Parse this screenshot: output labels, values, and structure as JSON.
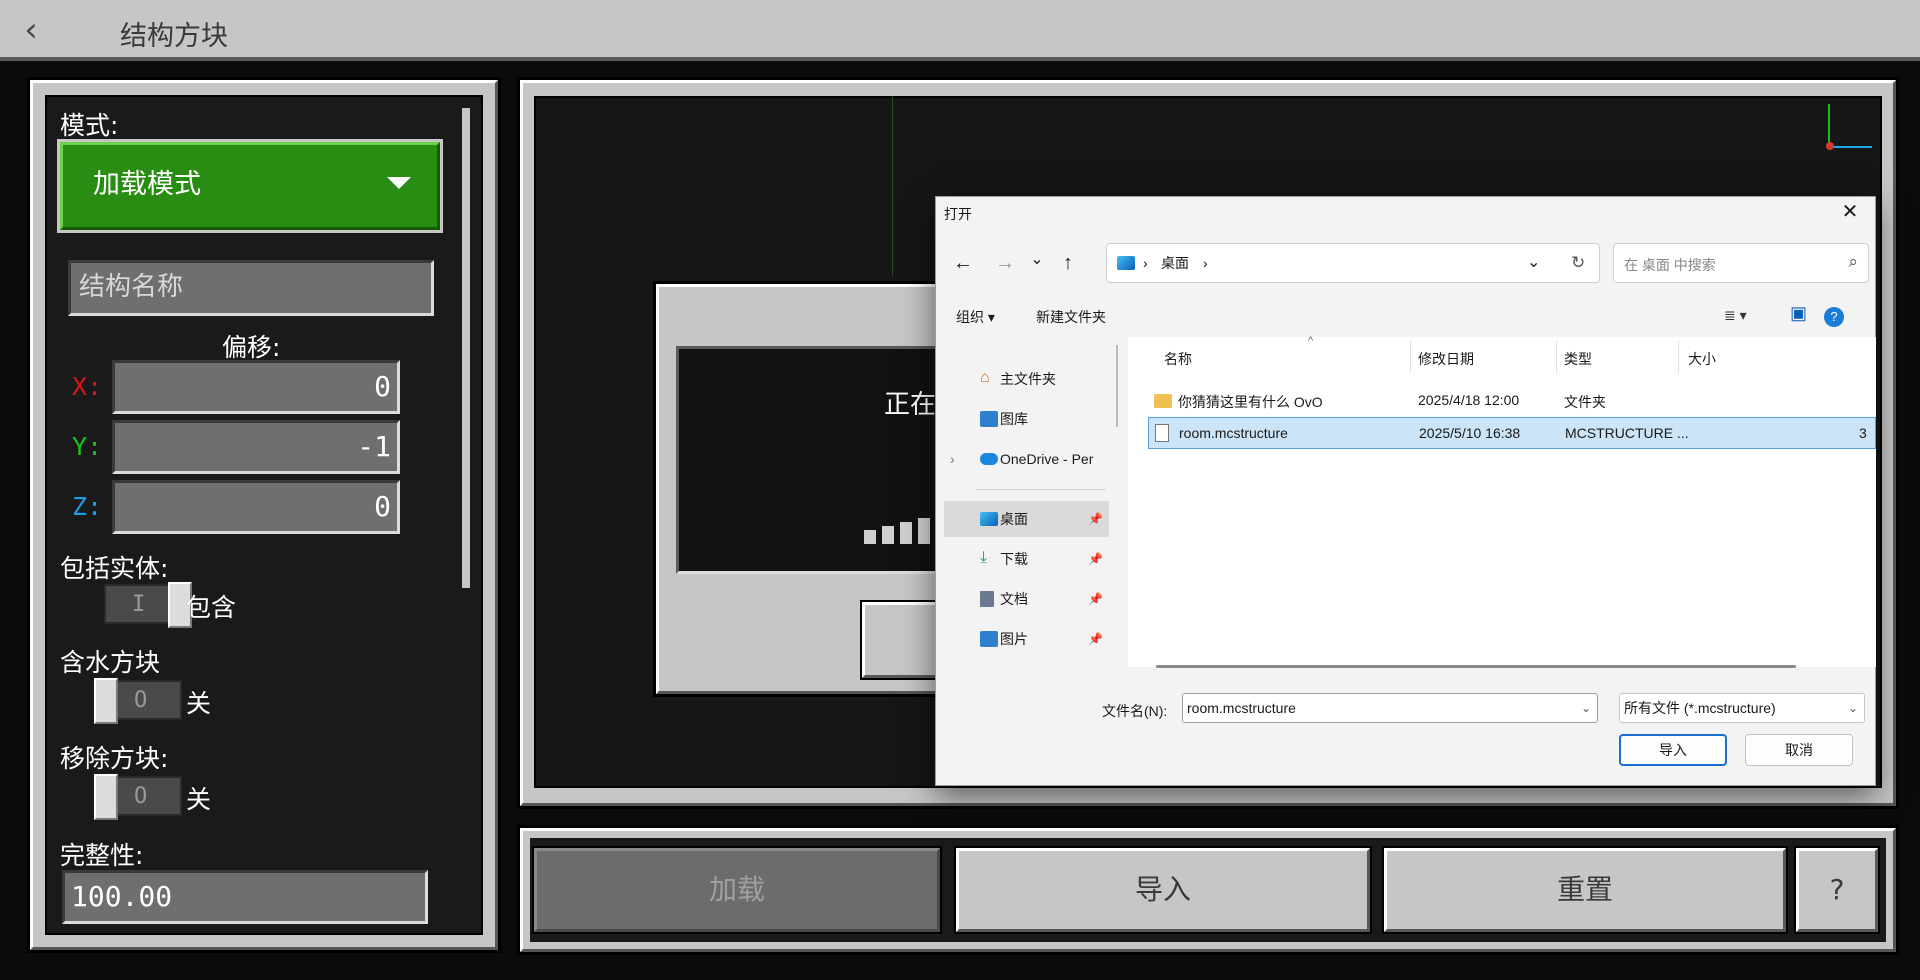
{
  "header": {
    "title": "结构方块",
    "back_icon": "‹"
  },
  "left_panel": {
    "mode_label": "模式:",
    "mode_value": "加载模式",
    "structure_name_placeholder": "结构名称",
    "offset_label": "偏移:",
    "offset": {
      "x_label": "X:",
      "x": "0",
      "y_label": "Y:",
      "y": "-1",
      "z_label": "Z:",
      "z": "0"
    },
    "axis_colors": {
      "x": "#d21919",
      "y": "#19c419",
      "z": "#1a9ee6"
    },
    "include_entities_label": "包括实体:",
    "include_entities_state": "包含",
    "waterlogged_label": "含水方块",
    "waterlogged_state": "关",
    "remove_blocks_label": "移除方块:",
    "remove_blocks_state": "关",
    "toggle_on_mark": "I",
    "toggle_off_mark": "O",
    "integrity_label": "完整性:",
    "integrity_value": "100.00"
  },
  "loading": {
    "text": "正在"
  },
  "bottom_bar": {
    "load": "加载",
    "import": "导入",
    "reset": "重置",
    "help": "?"
  },
  "dialog": {
    "title": "打开",
    "close": "✕",
    "nav": {
      "back": "←",
      "forward": "→",
      "recent": "⌄",
      "up": "↑"
    },
    "address": {
      "sep1": "›",
      "location": "桌面",
      "sep2": "›",
      "dropdown": "⌄",
      "refresh": "↻"
    },
    "search_placeholder": "在 桌面 中搜索",
    "search_icon": "⌕",
    "toolbar": {
      "organize": "组织 ▾",
      "new_folder": "新建文件夹",
      "view": "≣ ▾",
      "pane": "▣",
      "help": "?"
    },
    "nav_pane": {
      "home": "主文件夹",
      "gallery": "图库",
      "onedrive": "OneDrive - Per",
      "desktop": "桌面",
      "downloads": "下载",
      "documents": "文档",
      "pictures": "图片",
      "pin": "📌",
      "expand": "›"
    },
    "columns": {
      "name": "名称",
      "date": "修改日期",
      "type": "类型",
      "size": "大小",
      "sort_indicator": "^"
    },
    "files": [
      {
        "name": "你猜猜这里有什么 OvO",
        "date": "2025/4/18 12:00",
        "type": "文件夹",
        "size": ""
      },
      {
        "name": "room.mcstructure",
        "date": "2025/5/10 16:38",
        "type": "MCSTRUCTURE ...",
        "size": "3"
      }
    ],
    "filename_label": "文件名(N):",
    "filename_value": "room.mcstructure",
    "filetype_value": "所有文件 (*.mcstructure)",
    "dropdown_arrow": "⌄",
    "open_button": "导入",
    "cancel_button": "取消"
  }
}
